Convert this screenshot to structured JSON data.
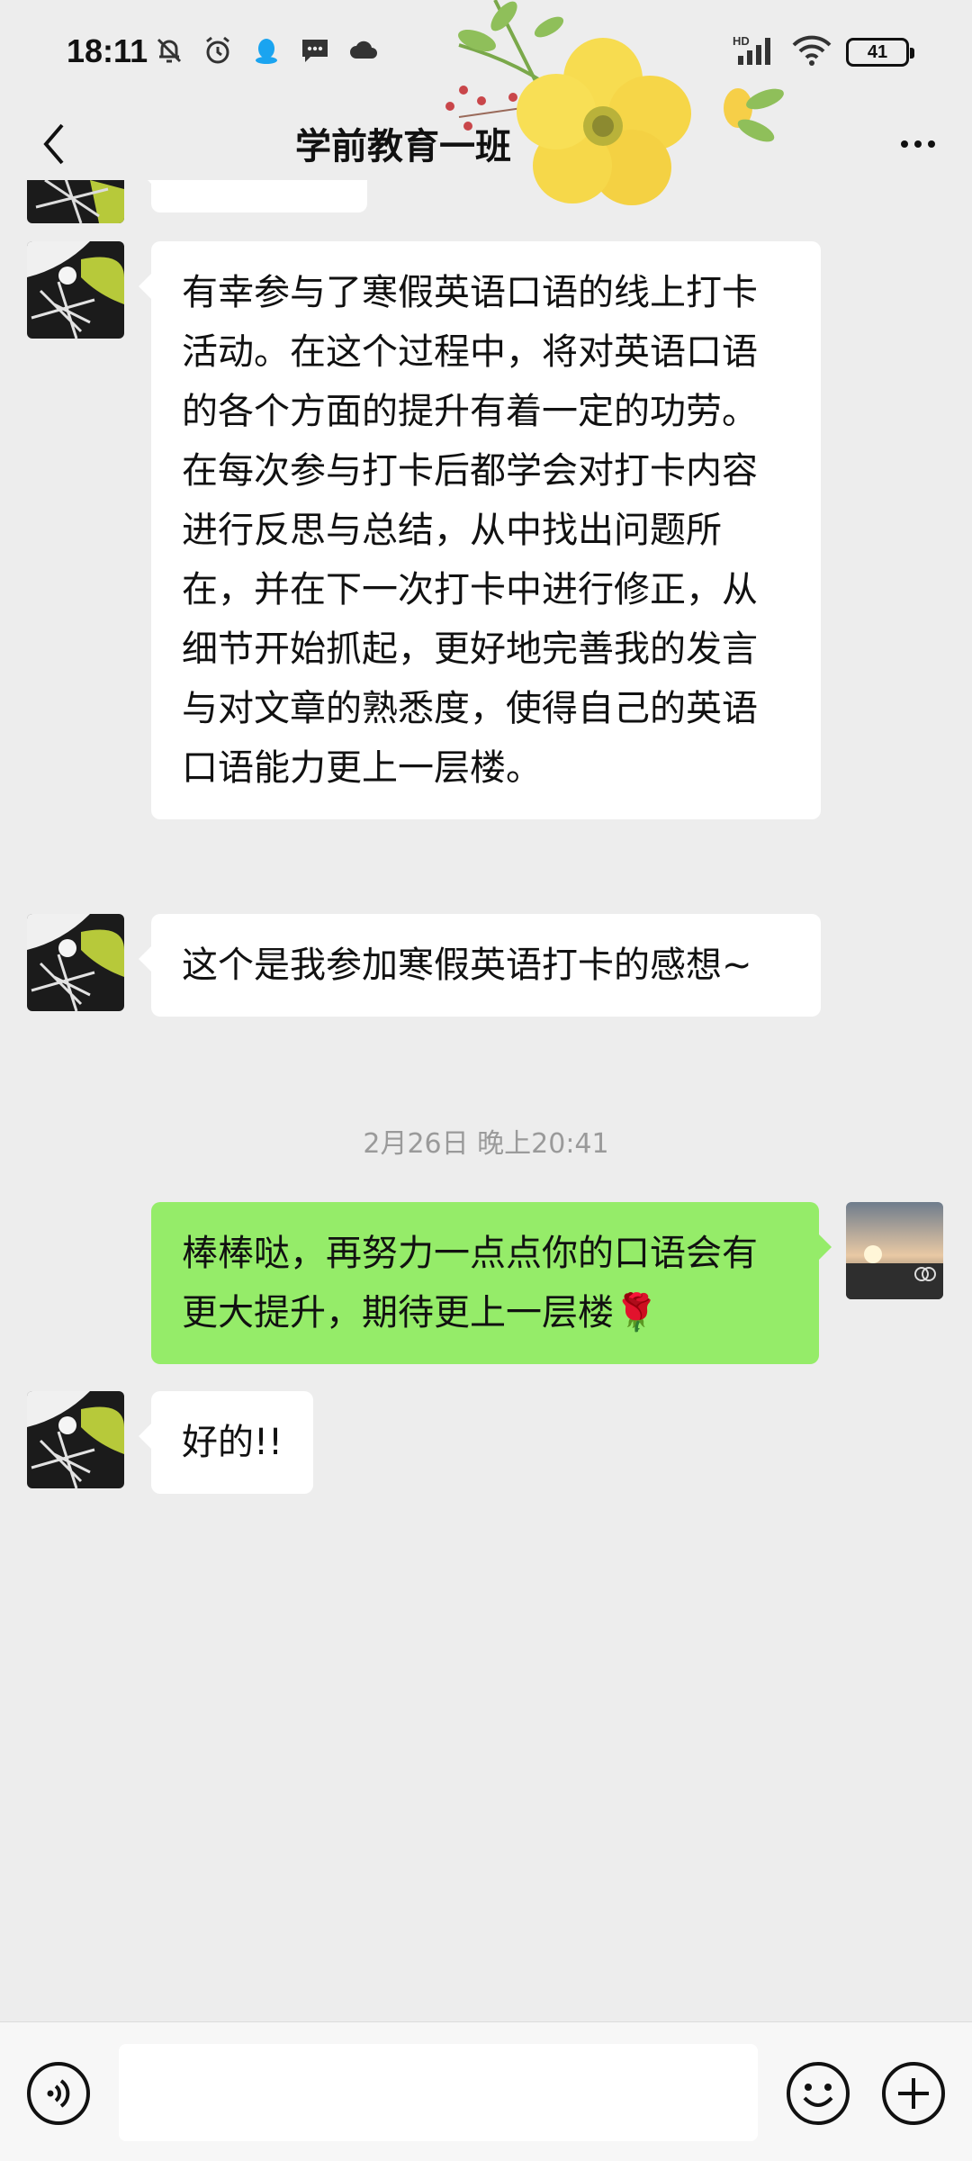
{
  "status_bar": {
    "time": "18:11",
    "battery": "41",
    "network_label": "HD",
    "icons_left": [
      "mute-bell-icon",
      "alarm-icon",
      "qq-icon",
      "message-icon",
      "cloud-icon"
    ],
    "icons_right": [
      "signal-icon",
      "wifi-icon",
      "battery-icon"
    ]
  },
  "header": {
    "title": "学前教育一班",
    "back_icon": "chevron-left-icon",
    "more_icon": "more-dots-icon"
  },
  "messages": [
    {
      "side": "left",
      "text": "有幸参与了寒假英语口语的线上打卡活动。在这个过程中，将对英语口语的各个方面的提升有着一定的功劳。在每次参与打卡后都学会对打卡内容进行反思与总结，从中找出问题所在，并在下一次打卡中进行修正，从细节开始抓起，更好地完善我的发言与对文章的熟悉度，使得自己的英语口语能力更上一层楼。"
    },
    {
      "side": "left",
      "text": "这个是我参加寒假英语打卡的感想~"
    },
    {
      "side": "right",
      "text": "棒棒哒，再努力一点点你的口语会有更大提升，期待更上一层楼🌹"
    },
    {
      "side": "left",
      "text": "好的!!"
    }
  ],
  "timestamp": "2月26日 晚上20:41",
  "input_bar": {
    "voice_icon": "voice-icon",
    "input_value": "",
    "emoji_icon": "emoji-icon",
    "plus_icon": "plus-icon"
  },
  "colors": {
    "background": "#ededed",
    "bubble_left": "#ffffff",
    "bubble_right": "#95ec69",
    "timestamp": "#9a9a9a"
  }
}
